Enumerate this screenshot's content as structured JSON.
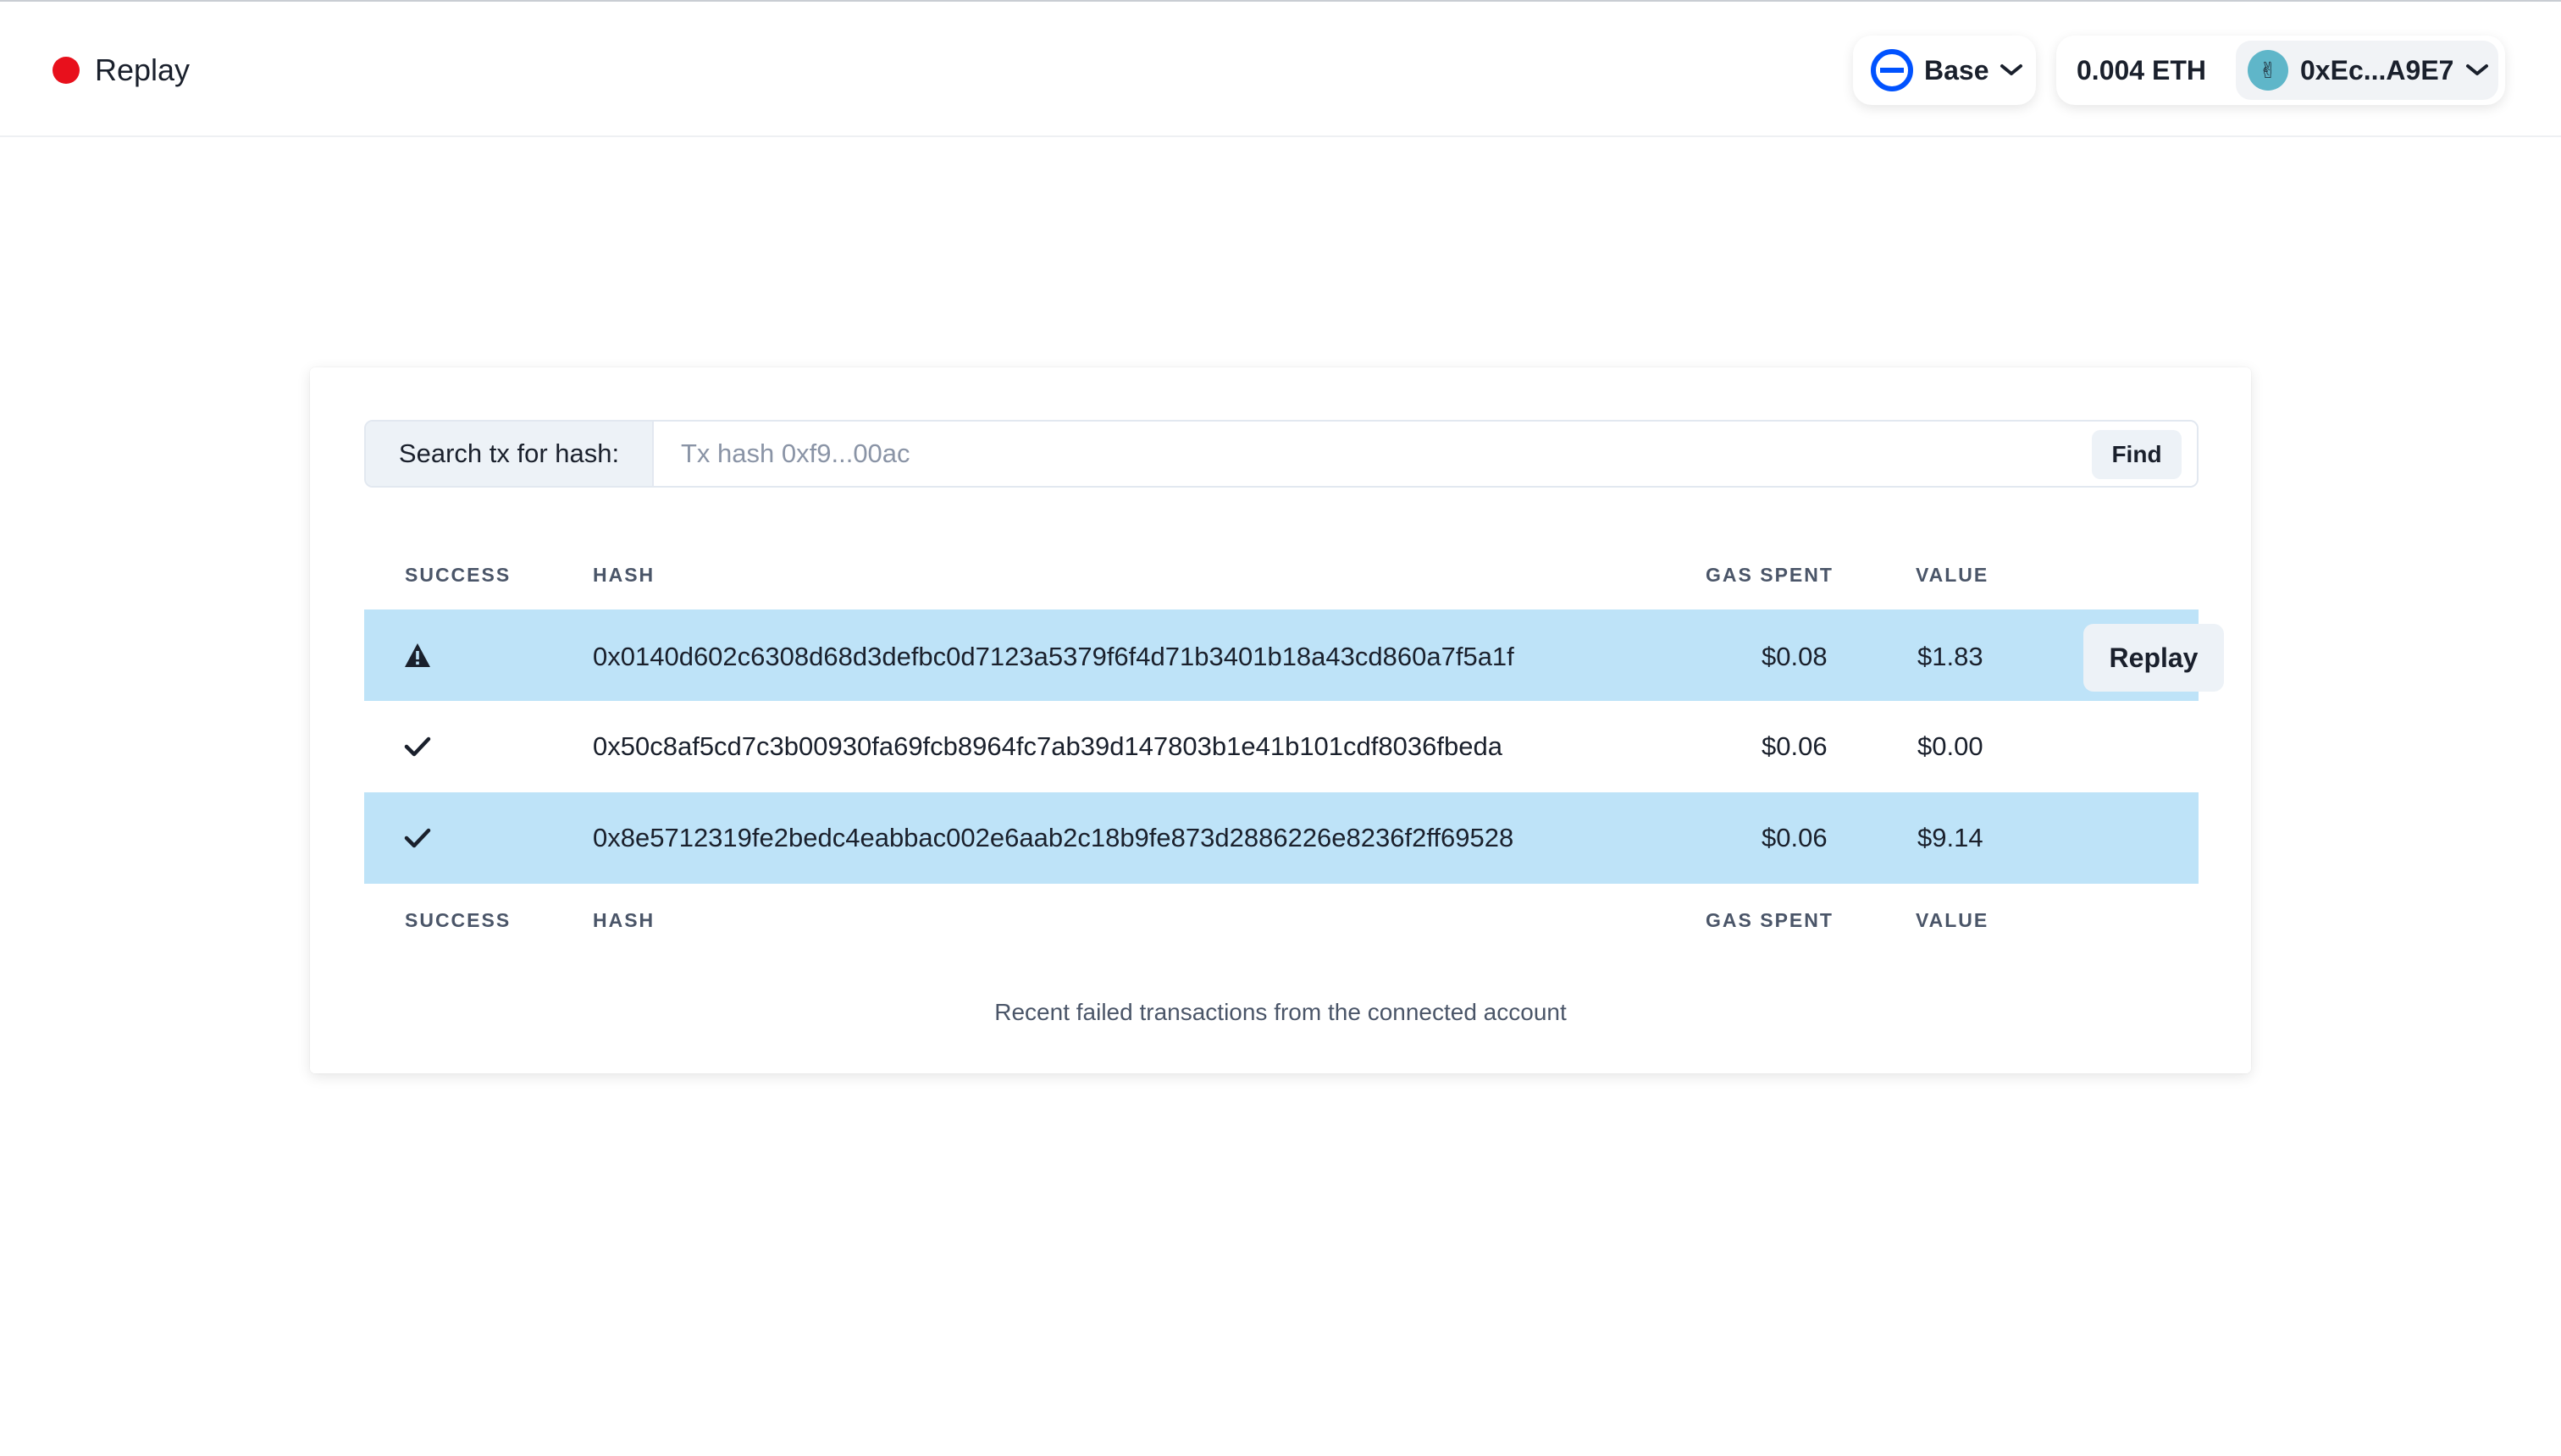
{
  "header": {
    "app_title": "Replay",
    "brand_color": "#e8101c",
    "network": {
      "label": "Base",
      "icon": "base-network-icon",
      "color": "#0052ff"
    },
    "balance": "0.004 ETH",
    "account": {
      "address": "0xEc...A9E7",
      "avatar": "avatar-icon"
    }
  },
  "search": {
    "label": "Search tx for hash:",
    "placeholder": "Tx hash 0xf9...00ac",
    "value": "",
    "button": "Find"
  },
  "table": {
    "columns": [
      "SUCCESS",
      "HASH",
      "GAS SPENT",
      "VALUE"
    ],
    "rows": [
      {
        "status": "warning-icon",
        "hash": "0x0140d602c6308d68d3defbc0d7123a5379f6f4d71b3401b18a43cd860a7f5a1f",
        "gas": "$0.08",
        "value": "$1.83",
        "action": "Replay",
        "highlighted": true
      },
      {
        "status": "check-icon",
        "hash": "0x50c8af5cd7c3b00930fa69fcb8964fc7ab39d147803b1e41b101cdf8036fbeda",
        "gas": "$0.06",
        "value": "$0.00",
        "highlighted": false
      },
      {
        "status": "check-icon",
        "hash": "0x8e5712319fe2bedc4eabbac002e6aab2c18b9fe873d2886226e8236f2ff69528",
        "gas": "$0.06",
        "value": "$9.14",
        "highlighted": true
      }
    ],
    "caption": "Recent failed transactions from the connected account",
    "highlight_color": "#bee3f8"
  }
}
